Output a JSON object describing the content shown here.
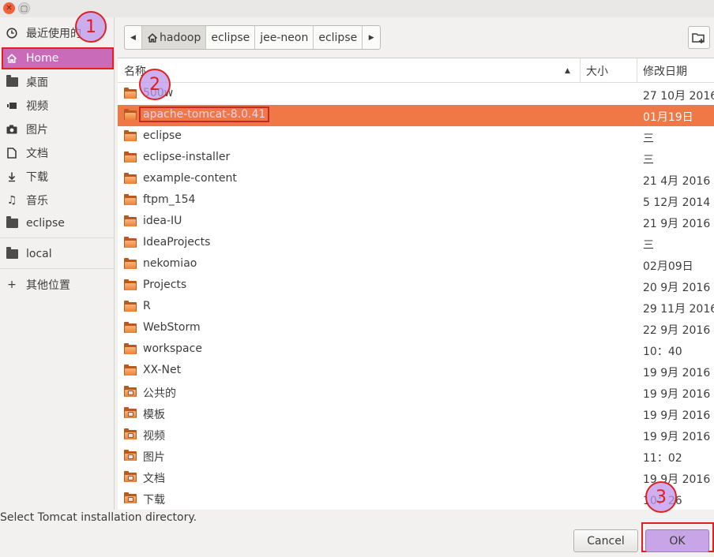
{
  "sidebar": {
    "items": [
      {
        "label": "最近使用的",
        "icon": "clock-icon"
      },
      {
        "label": "Home",
        "icon": "home-icon"
      },
      {
        "label": "桌面",
        "icon": "folder-icon"
      },
      {
        "label": "视频",
        "icon": "video-icon"
      },
      {
        "label": "图片",
        "icon": "camera-icon"
      },
      {
        "label": "文档",
        "icon": "document-icon"
      },
      {
        "label": "下载",
        "icon": "download-icon"
      },
      {
        "label": "音乐",
        "icon": "music-icon"
      },
      {
        "label": "eclipse",
        "icon": "folder-icon"
      },
      {
        "label": "local",
        "icon": "folder-icon"
      },
      {
        "label": "其他位置",
        "icon": "plus-icon"
      }
    ]
  },
  "pathbar": {
    "crumbs": [
      "hadoop",
      "eclipse",
      "jee-neon",
      "eclipse"
    ]
  },
  "columns": {
    "name": "名称",
    "size": "大小",
    "modified": "修改日期"
  },
  "files": [
    {
      "name": "500w",
      "date": "27 10月 2016"
    },
    {
      "name": "apache-tomcat-8.0.41",
      "date": "01月19日"
    },
    {
      "name": "eclipse",
      "date": "三"
    },
    {
      "name": "eclipse-installer",
      "date": "三"
    },
    {
      "name": "example-content",
      "date": "21 4月 2016"
    },
    {
      "name": "ftpm_154",
      "date": "5 12月 2014"
    },
    {
      "name": "idea-IU",
      "date": "21 9月 2016"
    },
    {
      "name": "IdeaProjects",
      "date": "三"
    },
    {
      "name": "nekomiao",
      "date": "02月09日"
    },
    {
      "name": "Projects",
      "date": "20 9月 2016"
    },
    {
      "name": "R",
      "date": "29 11月 2016"
    },
    {
      "name": "WebStorm",
      "date": "22 9月 2016"
    },
    {
      "name": "workspace",
      "date": "10：40"
    },
    {
      "name": "XX-Net",
      "date": "19 9月 2016"
    },
    {
      "name": "公共的",
      "date": "19 9月 2016"
    },
    {
      "name": "模板",
      "date": "19 9月 2016"
    },
    {
      "name": "视频",
      "date": "19 9月 2016"
    },
    {
      "name": "图片",
      "date": "11：02"
    },
    {
      "name": "文档",
      "date": "19 9月 2016"
    },
    {
      "name": "下载",
      "date": "10：26"
    }
  ],
  "selected_file": "apache-tomcat-8.0.41",
  "status": "Select Tomcat installation directory.",
  "buttons": {
    "cancel": "Cancel",
    "ok": "OK"
  },
  "annotations": [
    "1",
    "2",
    "3"
  ],
  "colors": {
    "selection": "#f07746",
    "sidebar_active": "#c96bb9",
    "highlight_frame": "#e02020",
    "ok_button": "#c7a5e6"
  }
}
